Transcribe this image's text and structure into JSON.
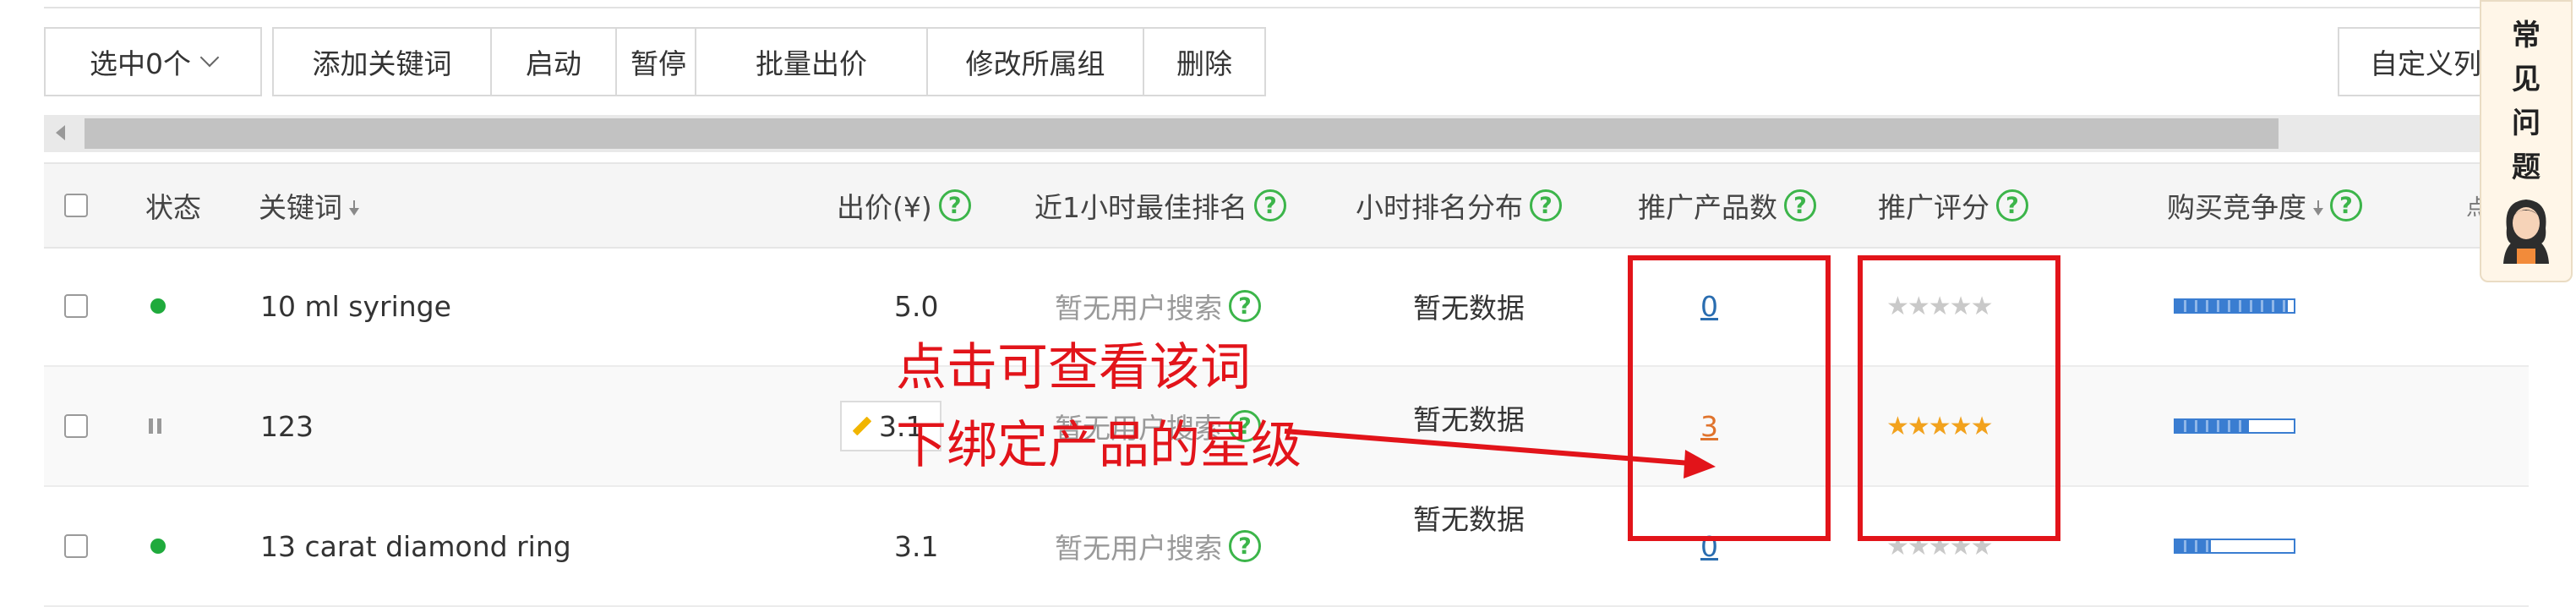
{
  "toolbar": {
    "select_label": "选中0个",
    "add_keyword": "添加关键词",
    "start": "启动",
    "pause": "暂停",
    "bulk_bid": "批量出价",
    "modify_group": "修改所属组",
    "delete": "删除",
    "custom_columns": "自定义列"
  },
  "faq": {
    "chars": [
      "常",
      "见",
      "问",
      "题"
    ]
  },
  "table": {
    "headers": {
      "status": "状态",
      "keyword": "关键词",
      "bid": "出价(¥)",
      "best_rank": "近1小时最佳排名",
      "rank_dist": "小时排名分布",
      "product_count": "推广产品数",
      "score": "推广评分",
      "competition": "购买竞争度",
      "extra": "点"
    },
    "help_glyph": "?",
    "rows": [
      {
        "status": "active",
        "keyword": "10 ml syringe",
        "bid": "5.0",
        "best_rank": "暂无用户搜索",
        "rank_dist": "暂无数据",
        "product_count": "0",
        "stars": "★★★★★",
        "rating_stars": 0,
        "competition": 0.95
      },
      {
        "status": "paused",
        "keyword": "123",
        "bid": "3.1",
        "best_rank": "暂无用户搜索",
        "rank_dist": "暂无数据",
        "product_count": "3",
        "stars": "★★★★★",
        "rating_stars": 5,
        "competition": 0.62
      },
      {
        "status": "active",
        "keyword": "13 carat diamond ring",
        "bid": "3.1",
        "best_rank": "暂无用户搜索",
        "rank_dist": "暂无数据",
        "product_count": "0",
        "stars": "★★★★★",
        "rating_stars": 0,
        "competition": 0.3
      }
    ]
  },
  "annotation": {
    "line1": "点击可查看该词",
    "line2": "下绑定产品的星级",
    "color": "#e2141a"
  }
}
